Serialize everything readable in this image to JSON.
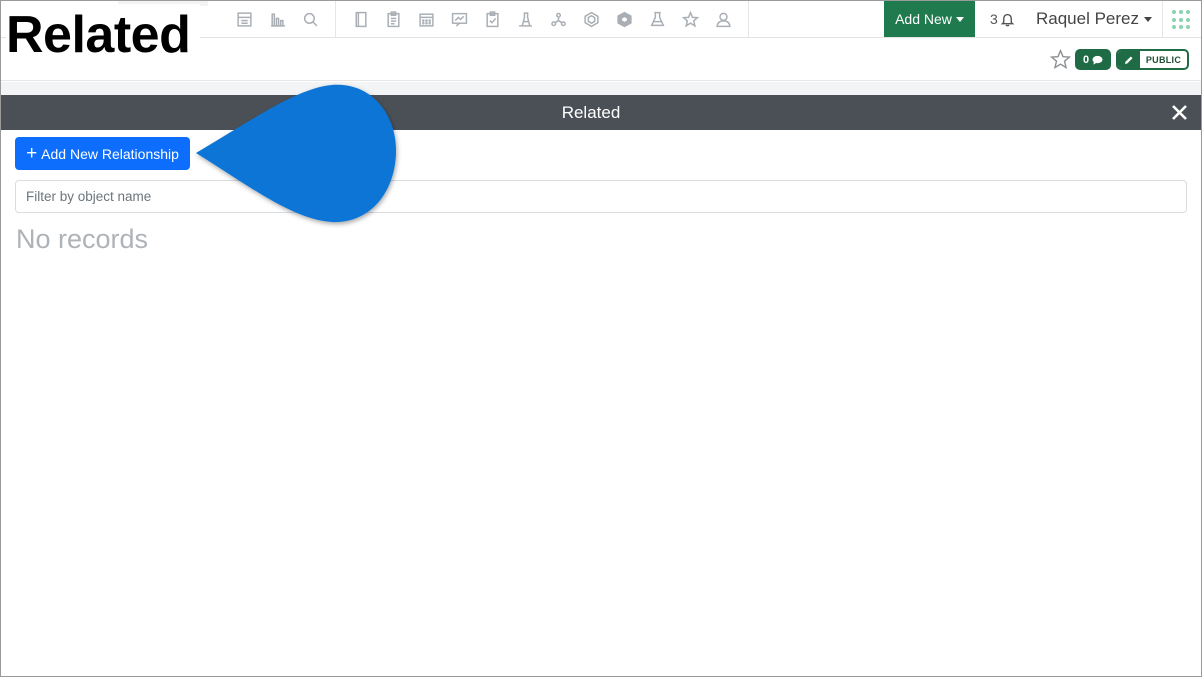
{
  "caption": "Related",
  "navbar": {
    "icons": [
      "dashboard-icon",
      "chart-bars-icon",
      "search-icon",
      "notebook-icon",
      "clipboard-icon",
      "calendar-icon",
      "presentation-icon",
      "checklist-icon",
      "lab-flask-icon",
      "network-icon",
      "hexagon-icon",
      "cube-icon",
      "beaker-icon",
      "star-icon",
      "user-icon"
    ],
    "add_new_label": "Add New",
    "notification_count": "3",
    "user_name": "Raquel Perez"
  },
  "subbar": {
    "comment_count": "0",
    "visibility_label": "PUBLIC"
  },
  "panel": {
    "title": "Related",
    "add_button_label": "Add New Relationship",
    "filter_placeholder": "Filter by object name",
    "empty_text": "No records"
  },
  "colors": {
    "brand_green": "#1f7a4d",
    "panel_header": "#4b5057",
    "primary_blue": "#0d6efd",
    "callout_blue": "#0a74d6"
  }
}
